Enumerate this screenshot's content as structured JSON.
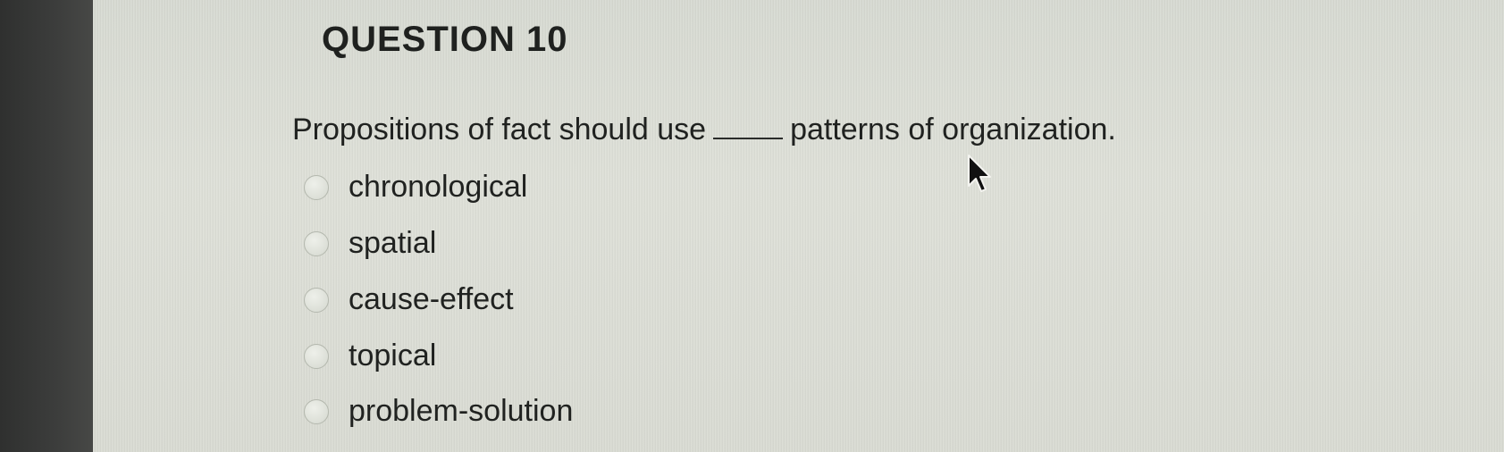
{
  "question": {
    "title": "QUESTION 10",
    "prompt_before": "Propositions of fact should use",
    "prompt_after": "patterns of organization."
  },
  "options": [
    {
      "label": "chronological",
      "selected": false
    },
    {
      "label": "spatial",
      "selected": false
    },
    {
      "label": "cause-effect",
      "selected": false
    },
    {
      "label": "topical",
      "selected": false
    },
    {
      "label": "problem-solution",
      "selected": false
    }
  ],
  "icons": {
    "cursor": "mouse-pointer-icon"
  }
}
